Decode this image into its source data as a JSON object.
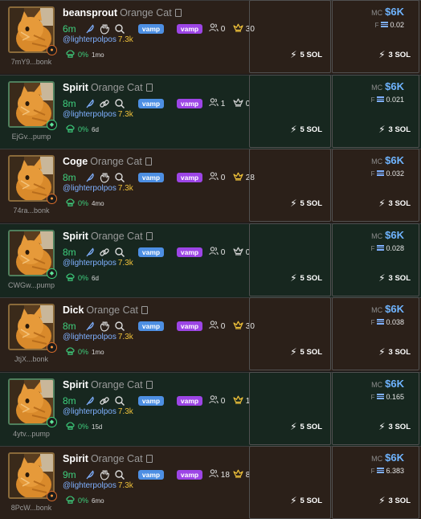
{
  "feed": {
    "rows": [
      {
        "platform": "bonk",
        "address": "7mY9...bonk",
        "name": "beansprout",
        "full_name": "Orange Cat",
        "age": "6m",
        "pill_blue": "vamp",
        "pill_purple": "vamp",
        "holders": "0",
        "top_holders": "30",
        "handle": "@lighterpolpos",
        "followers": "7.3k",
        "pct": "0%",
        "duration": "1mo",
        "buy_mid": "5 SOL",
        "buy_right": "3 SOL",
        "mc_label": "MC",
        "mc": "$6K",
        "f_label": "F",
        "f": "0.02",
        "icons": [
          "feather-icon",
          "clap-icon",
          "search-icon"
        ]
      },
      {
        "platform": "pump",
        "address": "EjGv...pump",
        "name": "Spirit",
        "full_name": "Orange Cat",
        "age": "8m",
        "pill_blue": "vamp",
        "pill_purple": "vamp",
        "holders": "1",
        "top_holders": "0",
        "handle": "@lighterpolpos",
        "followers": "7.3k",
        "pct": "0%",
        "duration": "6d",
        "buy_mid": "5 SOL",
        "buy_right": "3 SOL",
        "mc_label": "MC",
        "mc": "$6K",
        "f_label": "F",
        "f": "0.021",
        "icons": [
          "feather-icon",
          "link-icon",
          "search-icon"
        ]
      },
      {
        "platform": "bonk",
        "address": "74ra...bonk",
        "name": "Coge",
        "full_name": "Orange Cat",
        "age": "8m",
        "pill_blue": "vamp",
        "pill_purple": "vamp",
        "holders": "0",
        "top_holders": "28",
        "handle": "@lighterpolpos",
        "followers": "7.3k",
        "pct": "0%",
        "duration": "4mo",
        "buy_mid": "5 SOL",
        "buy_right": "3 SOL",
        "mc_label": "MC",
        "mc": "$6K",
        "f_label": "F",
        "f": "0.032",
        "icons": [
          "feather-icon",
          "clap-icon",
          "search-icon"
        ]
      },
      {
        "platform": "pump",
        "address": "CWGw...pump",
        "name": "Spirit",
        "full_name": "Orange Cat",
        "age": "8m",
        "pill_blue": "vamp",
        "pill_purple": "vamp",
        "holders": "0",
        "top_holders": "0",
        "handle": "@lighterpolpos",
        "followers": "7.3k",
        "pct": "0%",
        "duration": "6d",
        "buy_mid": "5 SOL",
        "buy_right": "3 SOL",
        "mc_label": "MC",
        "mc": "$6K",
        "f_label": "F",
        "f": "0.028",
        "icons": [
          "feather-icon",
          "link-icon",
          "search-icon"
        ]
      },
      {
        "platform": "bonk",
        "address": "JtjX...bonk",
        "name": "Dick",
        "full_name": "Orange Cat",
        "age": "8m",
        "pill_blue": "vamp",
        "pill_purple": "vamp",
        "holders": "0",
        "top_holders": "30",
        "handle": "@lighterpolpos",
        "followers": "7.3k",
        "pct": "0%",
        "duration": "1mo",
        "buy_mid": "5 SOL",
        "buy_right": "3 SOL",
        "mc_label": "MC",
        "mc": "$6K",
        "f_label": "F",
        "f": "0.038",
        "icons": [
          "feather-icon",
          "clap-icon",
          "search-icon"
        ]
      },
      {
        "platform": "pump",
        "address": "4ytv...pump",
        "name": "Spirit",
        "full_name": "Orange Cat",
        "age": "8m",
        "pill_blue": "vamp",
        "pill_purple": "vamp",
        "holders": "0",
        "top_holders": "1",
        "handle": "@lighterpolpos",
        "followers": "7.3k",
        "pct": "0%",
        "duration": "15d",
        "buy_mid": "5 SOL",
        "buy_right": "3 SOL",
        "mc_label": "MC",
        "mc": "$6K",
        "f_label": "F",
        "f": "0.165",
        "icons": [
          "feather-icon",
          "link-icon",
          "search-icon"
        ]
      },
      {
        "platform": "bonk",
        "address": "8PcW...bonk",
        "name": "Spirit",
        "full_name": "Orange Cat",
        "age": "9m",
        "pill_blue": "vamp",
        "pill_purple": "vamp",
        "holders": "18",
        "top_holders": "8",
        "handle": "@lighterpolpos",
        "followers": "7.3k",
        "pct": "0%",
        "duration": "6mo",
        "buy_mid": "5 SOL",
        "buy_right": "3 SOL",
        "mc_label": "MC",
        "mc": "$6K",
        "f_label": "F",
        "f": "6.383",
        "icons": [
          "feather-icon",
          "clap-icon",
          "search-icon"
        ]
      }
    ]
  },
  "colors": {
    "bonk_row_bg": "#2b2019",
    "pump_row_bg": "#17271f",
    "age_green": "#3ed07e",
    "mc_blue": "#6fb4ff",
    "pill_blue": "#4d8fe3",
    "pill_purple": "#9d45e6",
    "followers_gold": "#f0c23a"
  }
}
